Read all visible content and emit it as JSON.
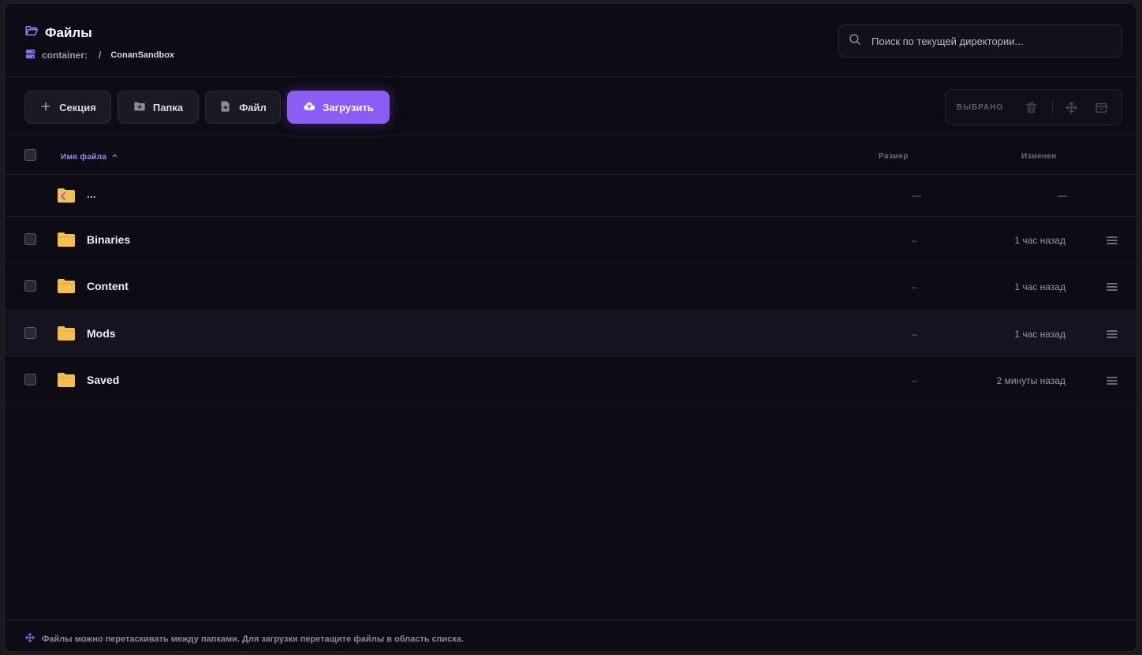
{
  "header": {
    "title": "Файлы",
    "breadcrumb": {
      "root": "container:",
      "separator": "/",
      "current": "ConanSandbox"
    },
    "search_placeholder": "Поиск по текущей директории..."
  },
  "toolbar": {
    "section_label": "Секция",
    "folder_label": "Папка",
    "file_label": "Файл",
    "upload_label": "Загрузить",
    "selected_label": "ВЫБРАНО"
  },
  "table": {
    "columns": {
      "name": "Имя файла",
      "size": "Размер",
      "modified": "Изменен"
    },
    "parent_row": {
      "name": "...",
      "size": "—",
      "modified": "—"
    },
    "rows": [
      {
        "name": "Binaries",
        "size": "–",
        "modified": "1 час назад"
      },
      {
        "name": "Content",
        "size": "–",
        "modified": "1 час назад"
      },
      {
        "name": "Mods",
        "size": "–",
        "modified": "1 час назад"
      },
      {
        "name": "Saved",
        "size": "–",
        "modified": "2 минуты назад"
      }
    ]
  },
  "footer": {
    "hint": "Файлы можно перетаскивать между папками. Для загрузки перетащите файлы в область списка."
  },
  "colors": {
    "accent": "#8b5cf6",
    "folder": "#f5c04a",
    "background": "#0d0c14"
  },
  "icons": {
    "title": "folder-open-icon",
    "breadcrumb": "drive-icon",
    "search": "search-icon",
    "section": "plus-icon",
    "folder_button": "folder-plus-icon",
    "file_button": "file-plus-icon",
    "upload": "cloud-upload-icon",
    "delete": "trash-icon",
    "move": "move-icon",
    "archive": "archive-icon",
    "row_menu": "menu-icon",
    "hint": "move-icon"
  }
}
